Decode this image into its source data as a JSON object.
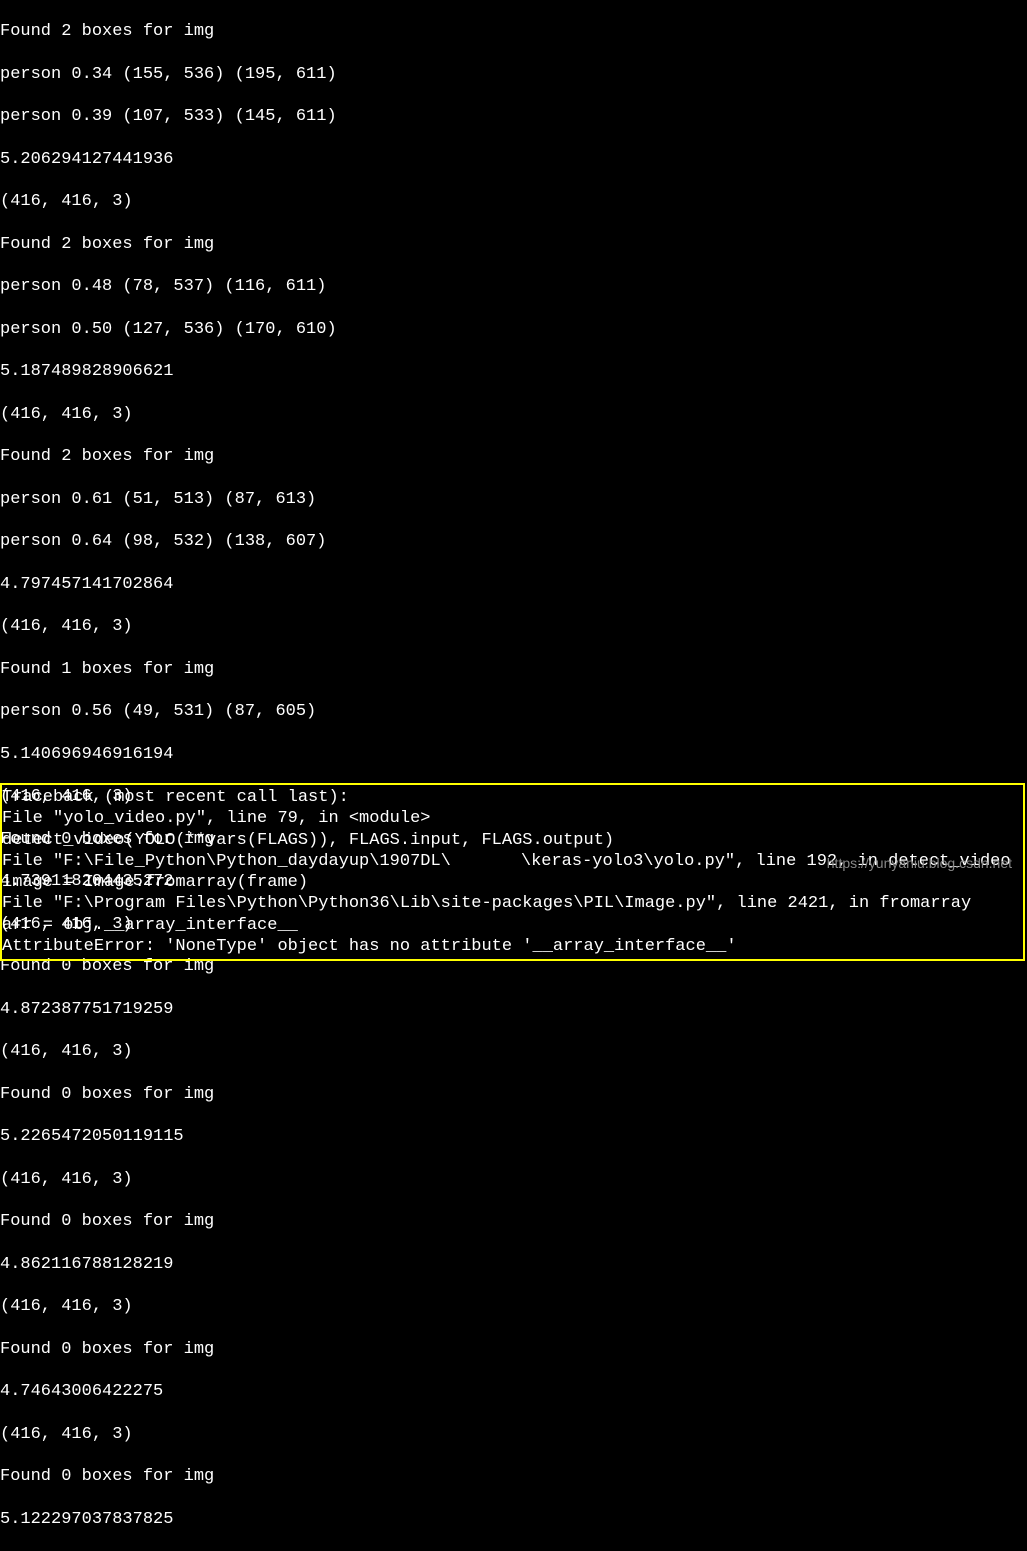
{
  "terminal": {
    "lines": [
      "Found 2 boxes for img",
      "person 0.34 (155, 536) (195, 611)",
      "person 0.39 (107, 533) (145, 611)",
      "5.206294127441936",
      "(416, 416, 3)",
      "Found 2 boxes for img",
      "person 0.48 (78, 537) (116, 611)",
      "person 0.50 (127, 536) (170, 610)",
      "5.187489828906621",
      "(416, 416, 3)",
      "Found 2 boxes for img",
      "person 0.61 (51, 513) (87, 613)",
      "person 0.64 (98, 532) (138, 607)",
      "4.797457141702864",
      "(416, 416, 3)",
      "Found 1 boxes for img",
      "person 0.56 (49, 531) (87, 605)",
      "5.140696946916194",
      "(416, 416, 3)",
      "Found 0 boxes for img",
      "4.739118204435272",
      "(416, 416, 3)",
      "Found 0 boxes for img",
      "4.872387751719259",
      "(416, 416, 3)",
      "Found 0 boxes for img",
      "5.2265472050119115",
      "(416, 416, 3)",
      "Found 0 boxes for img",
      "4.862116788128219",
      "(416, 416, 3)",
      "Found 0 boxes for img",
      "4.74643006422275",
      "(416, 416, 3)",
      "Found 0 boxes for img",
      "5.122297037837825"
    ]
  },
  "traceback": {
    "header": "Traceback (most recent call last):",
    "frames": [
      {
        "file_line": "  File \"yolo_video.py\", line 79, in <module>",
        "code_line": "    detect_video(YOLO(**vars(FLAGS)), FLAGS.input, FLAGS.output)"
      },
      {
        "file_line_pre": "  File \"F:\\File_Python\\Python_daydayup\\1907DL\\",
        "file_line_post": "\\keras-yolo3\\yolo.py\", line 192, in detect_video",
        "code_line": "    image = Image.fromarray(frame)"
      },
      {
        "file_line": "  File \"F:\\Program Files\\Python\\Python36\\Lib\\site-packages\\PIL\\Image.py\", line 2421, in fromarray",
        "code_line": "    arr = obj.__array_interface__"
      }
    ],
    "error": "AttributeError: 'NoneType' object has no attribute '__array_interface__'"
  },
  "watermark": "https://yunyaniu.blog.csdn.net"
}
